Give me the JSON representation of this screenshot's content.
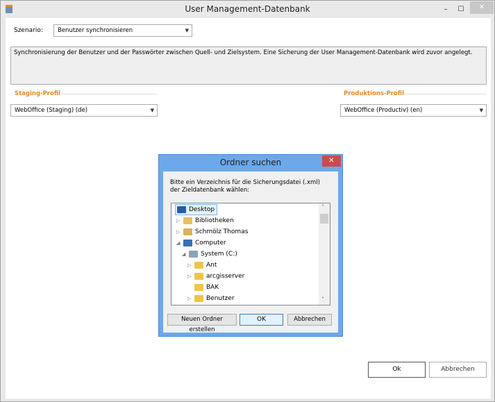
{
  "window": {
    "title": "User Management-Datenbank",
    "minimize": "–",
    "maximize": "☐",
    "close": "✕"
  },
  "scenario": {
    "label": "Szenario:",
    "value": "Benutzer synchronisieren"
  },
  "description": "Synchronisierung der Benutzer und der Passwörter zwischen Quell- und Zielsystem. Eine Sicherung der User Management-Datenbank wird zuvor angelegt.",
  "staging": {
    "label": "Staging-Profil",
    "value": "WebOffice (Staging) (de)"
  },
  "production": {
    "label": "Produktions-Profil",
    "value": "WebOffice (Productiv) (en)"
  },
  "buttons": {
    "ok": "Ok",
    "cancel": "Abbrechen"
  },
  "dialog": {
    "title": "Ordner suchen",
    "close": "✕",
    "prompt": "Bitte ein Verzeichnis für die Sicherungsdatei (.xml) der Zieldatenbank wählen:",
    "tree": [
      {
        "label": "Desktop",
        "expander": "",
        "selected": true
      },
      {
        "label": "Bibliotheken",
        "expander": "▷"
      },
      {
        "label": "Schmölz Thomas",
        "expander": "▷"
      },
      {
        "label": "Computer",
        "expander": "◢"
      },
      {
        "label": "System (C:)",
        "expander": "◢"
      },
      {
        "label": "Ant",
        "expander": "▷"
      },
      {
        "label": "arcgisserver",
        "expander": "▷"
      },
      {
        "label": "BAK",
        "expander": ""
      },
      {
        "label": "Benutzer",
        "expander": "▷"
      }
    ],
    "buttons": {
      "new_folder": "Neuen Ordner erstellen",
      "ok": "OK",
      "cancel": "Abbrechen"
    }
  }
}
